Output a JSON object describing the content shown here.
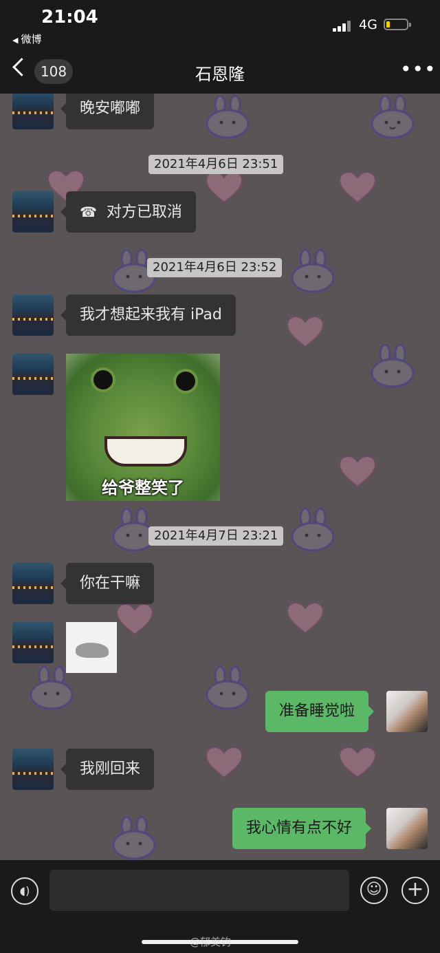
{
  "status_bar": {
    "time": "21:04",
    "back_app": "微博",
    "network": "4G",
    "battery_color": "#f5d000"
  },
  "nav": {
    "unread_count": "108",
    "title": "石恩隆",
    "more_icon": "more-dots-icon"
  },
  "messages": [
    {
      "side": "in",
      "text": "晚安嘟嘟"
    },
    {
      "timestamp": "2021年4月6日 23:51"
    },
    {
      "side": "in",
      "text": "对方已取消",
      "icon": "hangup-icon"
    },
    {
      "timestamp": "2021年4月6日 23:52"
    },
    {
      "side": "in",
      "text": "我才想起来我有 iPad"
    },
    {
      "side": "in",
      "sticker": "frog-sticker",
      "caption": "给爷整笑了"
    },
    {
      "timestamp": "2021年4月7日 23:21"
    },
    {
      "side": "in",
      "text": "你在干嘛"
    },
    {
      "side": "in",
      "sticker": "seal-sticker"
    },
    {
      "side": "out",
      "text": "准备睡觉啦"
    },
    {
      "side": "in",
      "text": "我刚回来"
    },
    {
      "side": "out",
      "text": "我心情有点不好"
    }
  ],
  "input_bar": {
    "voice_icon": "voice-icon",
    "text_value": "",
    "emoji_icon": "emoji-icon",
    "plus_icon": "plus-icon"
  },
  "watermark": "@郁美钓",
  "colors": {
    "chat_background": "#5b5456",
    "incoming_bubble": "#333333",
    "outgoing_bubble": "#5ab867",
    "bars": "#1a1a1a"
  }
}
